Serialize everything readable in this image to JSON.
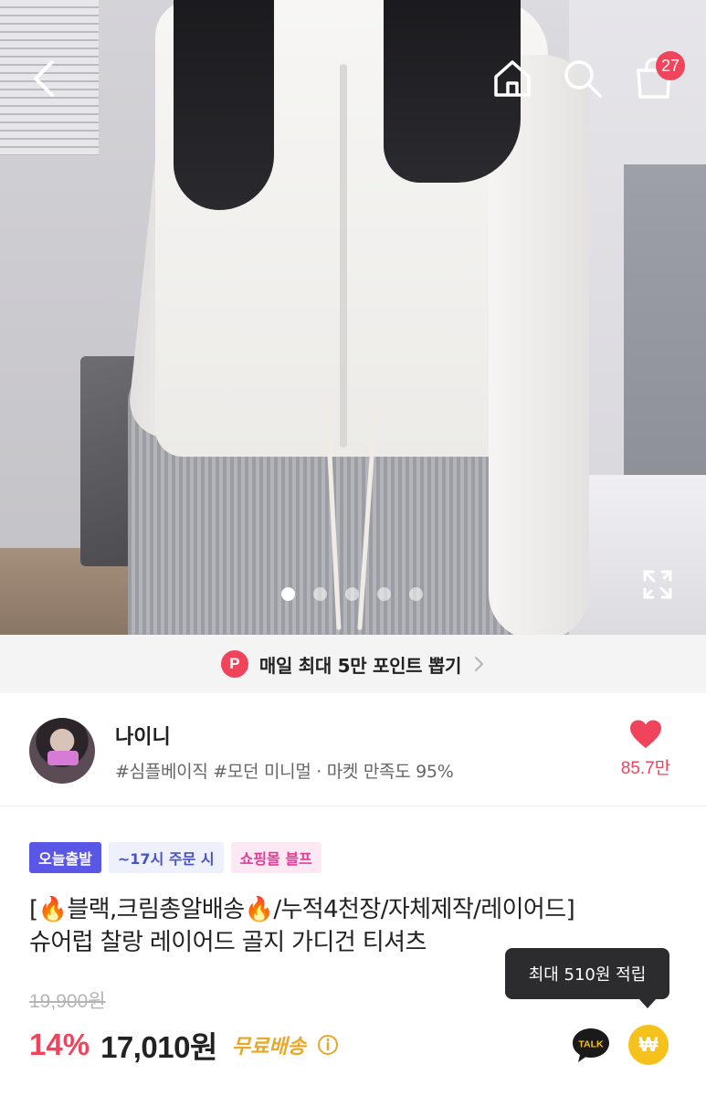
{
  "header": {
    "cart_count": "27"
  },
  "gallery": {
    "image_count": 5,
    "active_index": 0
  },
  "point_banner": {
    "badge": "P",
    "text": "매일 최대 5만 포인트 뽑기"
  },
  "seller": {
    "name": "나이니",
    "tags": "#심플베이직 #모던 미니멀 · 마켓 만족도 95%",
    "likes": "85.7만"
  },
  "product": {
    "badges": [
      "오늘출발",
      "~17시 주문 시",
      "쇼핑몰 블프"
    ],
    "title_line1": "[🔥블랙,크림총알배송🔥/누적4천장/자체제작/레이어드]",
    "title_line2": "슈어럽 찰랑 레이어드 골지 가디건 티셔츠",
    "original_price": "19,900원",
    "discount": "14%",
    "price": "17,010원",
    "shipping": "무료배송",
    "reward_tooltip": "최대 510원 적립",
    "talk_label": "TALK",
    "reward_icon": "₩"
  },
  "colors": {
    "accent": "#f0445c",
    "today_badge": "#5b57e6",
    "free_shipping": "#e8a82a",
    "reward": "#f5c21b"
  }
}
